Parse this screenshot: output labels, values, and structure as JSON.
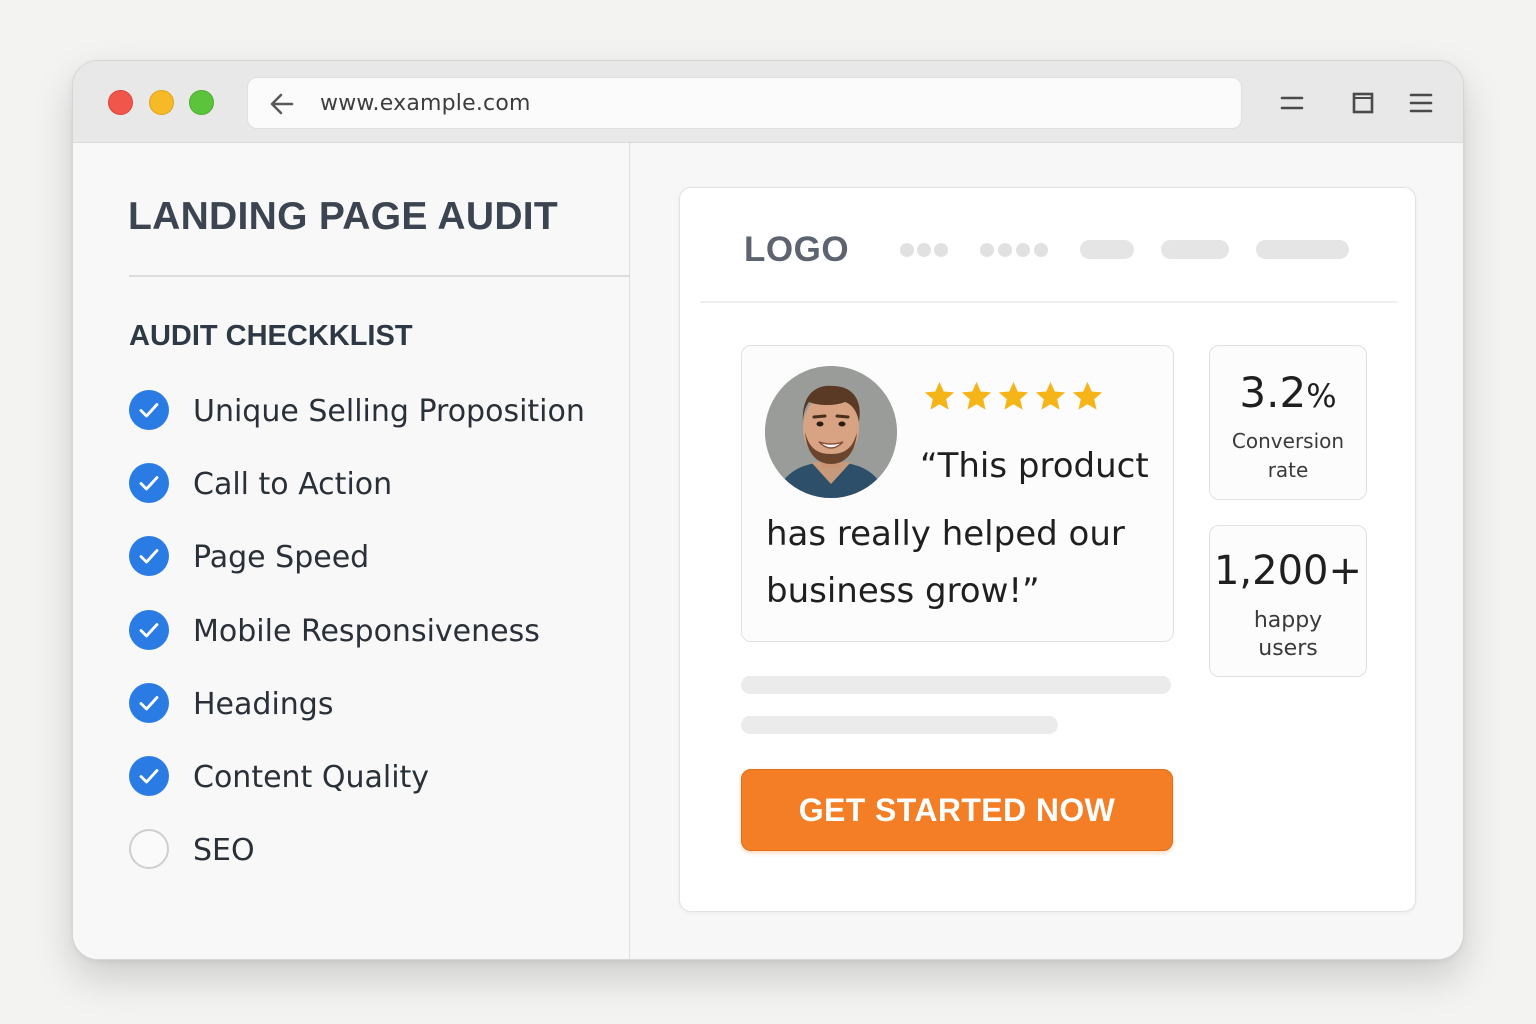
{
  "browser": {
    "url": "www.example.com",
    "traffic_lights": [
      "close",
      "minimize",
      "maximize"
    ],
    "toolbar_icons": [
      "minimize-icon",
      "window-icon",
      "menu-icon"
    ]
  },
  "audit": {
    "title": "LANDING PAGE AUDIT",
    "checklist_title": "AUDIT CHECKKLIST",
    "items": [
      {
        "label": "Unique Selling Proposition",
        "checked": true
      },
      {
        "label": "Call to Action",
        "checked": true
      },
      {
        "label": "Page Speed",
        "checked": true
      },
      {
        "label": "Mobile Responsiveness",
        "checked": true
      },
      {
        "label": "Headings",
        "checked": true
      },
      {
        "label": "Content Quality",
        "checked": true
      },
      {
        "label": "SEO",
        "checked": false
      }
    ]
  },
  "preview": {
    "logo": "LOGO",
    "testimonial": {
      "rating": 5,
      "quote_line1": "“This product",
      "quote_line2": "has really helped our",
      "quote_line3": "business grow!”"
    },
    "stats": [
      {
        "value": "3.2",
        "unit": "%",
        "label_line1": "Conversion",
        "label_line2": "rate"
      },
      {
        "value": "1,200+",
        "label_line1": "happy",
        "label_line2": "users"
      }
    ],
    "cta_label": "GET STARTED NOW"
  },
  "colors": {
    "accent_blue": "#2a7be4",
    "cta_orange": "#f47e26",
    "star_gold": "#f5b418"
  }
}
